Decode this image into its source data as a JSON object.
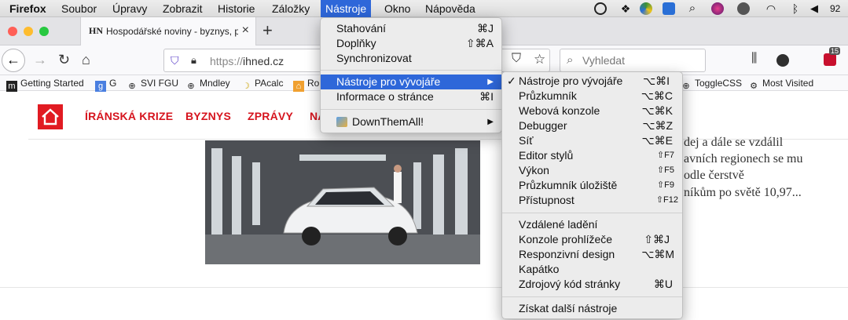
{
  "menubar": {
    "app": "Firefox",
    "items": [
      "Soubor",
      "Úpravy",
      "Zobrazit",
      "Historie",
      "Záložky",
      "Nástroje",
      "Okno",
      "Nápověda"
    ],
    "clock": "92"
  },
  "tab": {
    "favicon": "HN",
    "title": "Hospodářské noviny - byznys, p",
    "close": "×"
  },
  "newtab": "+",
  "nav": {
    "url_scheme": "https://",
    "url_host": "ihned.cz",
    "search_placeholder": "Vyhledat",
    "abp_badge": "15"
  },
  "bookmarks": [
    "Getting Started",
    "G",
    "SVI FGU",
    "Mndley",
    "PAcalc",
    "Ro",
    "ToggleCSS",
    "Most Visited"
  ],
  "site": {
    "nav": [
      "ÍRÁNSKÁ KRIZE",
      "BYZNYS",
      "ZPRÁVY",
      "NA"
    ],
    "article_lines": [
      "dej a dále se vzdálil",
      "avních regionech se mu",
      "odle čerstvě",
      "níkům po světě 10,97..."
    ]
  },
  "tools_menu": {
    "items": [
      {
        "label": "Stahování",
        "shortcut": "⌘J"
      },
      {
        "label": "Doplňky",
        "shortcut": "⇧⌘A"
      },
      {
        "label": "Synchronizovat",
        "shortcut": ""
      },
      {
        "label": "Nástroje pro vývojáře",
        "shortcut": "▶"
      },
      {
        "label": "Informace o stránce",
        "shortcut": "⌘I"
      },
      {
        "label": "DownThemAll!",
        "shortcut": "▶"
      }
    ]
  },
  "dev_menu": {
    "checkmark": "✓",
    "items": [
      {
        "label": "Nástroje pro vývojáře",
        "shortcut": "⌥⌘I"
      },
      {
        "label": "Průzkumník",
        "shortcut": "⌥⌘C"
      },
      {
        "label": "Webová konzole",
        "shortcut": "⌥⌘K"
      },
      {
        "label": "Debugger",
        "shortcut": "⌥⌘Z"
      },
      {
        "label": "Síť",
        "shortcut": "⌥⌘E"
      },
      {
        "label": "Editor stylů",
        "shortcut": "⇧F7"
      },
      {
        "label": "Výkon",
        "shortcut": "⇧F5"
      },
      {
        "label": "Průzkumník úložiště",
        "shortcut": "⇧F9"
      },
      {
        "label": "Přístupnost",
        "shortcut": "⇧F12"
      },
      {
        "label": "Vzdálené ladění",
        "shortcut": ""
      },
      {
        "label": "Konzole prohlížeče",
        "shortcut": "⇧⌘J"
      },
      {
        "label": "Responzivní design",
        "shortcut": "⌥⌘M"
      },
      {
        "label": "Kapátko",
        "shortcut": ""
      },
      {
        "label": "Zdrojový kód stránky",
        "shortcut": "⌘U"
      },
      {
        "label": "Získat další nástroje",
        "shortcut": ""
      }
    ]
  },
  "colors": {
    "accent": "#2e67d9",
    "brand_red": "#e11b22"
  }
}
